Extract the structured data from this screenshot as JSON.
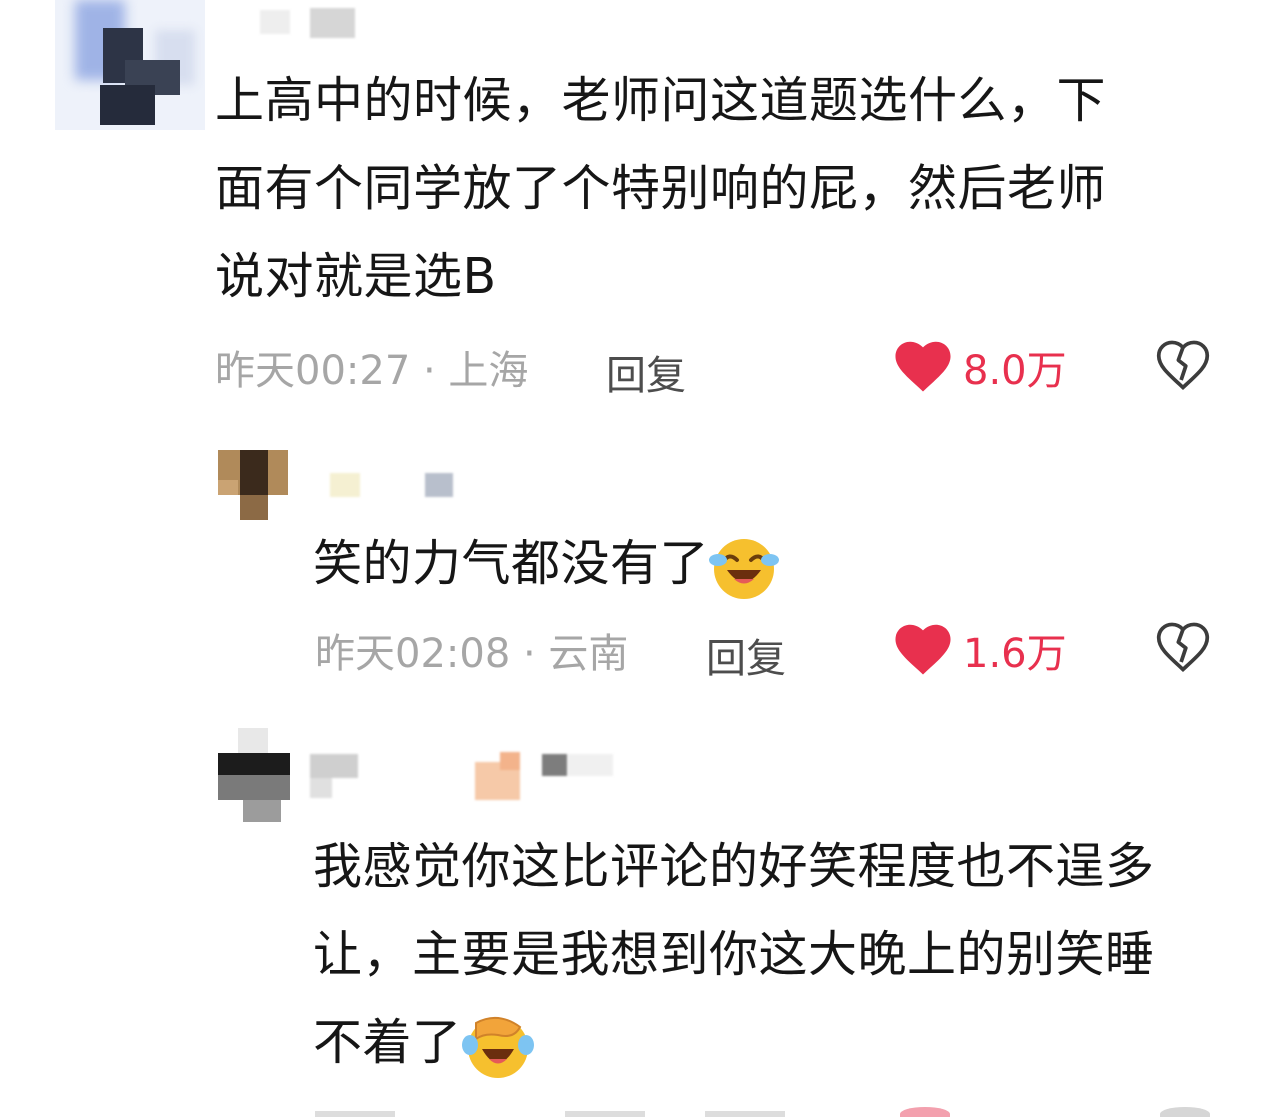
{
  "comments": [
    {
      "text_lines": [
        "上高中的时候，老师问这道题选什么，下",
        "面有个同学放了个特别响的屁，然后老师",
        "说对就是选B"
      ],
      "meta": "昨天00:27 · 上海",
      "reply_label": "回复",
      "like_count": "8.0万"
    },
    {
      "text": "笑的力气都没有了",
      "emoji": "crying-laughing-emoji",
      "meta": "昨天02:08 · 云南",
      "reply_label": "回复",
      "like_count": "1.6万"
    },
    {
      "text_lines": [
        "我感觉你这比评论的好笑程度也不逞多",
        "让，主要是我想到你这大晚上的别笑睡",
        "不着了"
      ],
      "emoji": "facepalm-laughing-emoji"
    }
  ],
  "colors": {
    "like": "#e8304e",
    "meta": "#a6a6a6",
    "reply": "#4d4d4d",
    "text": "#161616"
  }
}
